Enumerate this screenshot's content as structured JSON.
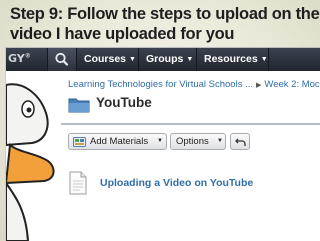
{
  "slide": {
    "title_line1": "Step 9: Follow the steps to upload on the",
    "title_line2": "video I have uploaded for you"
  },
  "topbar": {
    "logo_fragment": "GY",
    "nav": [
      {
        "label": "Courses"
      },
      {
        "label": "Groups"
      },
      {
        "label": "Resources"
      }
    ]
  },
  "breadcrumb": {
    "course": "Learning Technologies for Virtual Schools ...",
    "current": "Week 2: Moc"
  },
  "page": {
    "title": "YouTube"
  },
  "toolbar": {
    "add_materials_label": "Add Materials",
    "options_label": "Options"
  },
  "materials": [
    {
      "title": "Uploading a Video on YouTube"
    }
  ],
  "colors": {
    "nav_bg": "#2b313b",
    "link": "#2f6ea8",
    "slide_bg": "#eeede0"
  }
}
